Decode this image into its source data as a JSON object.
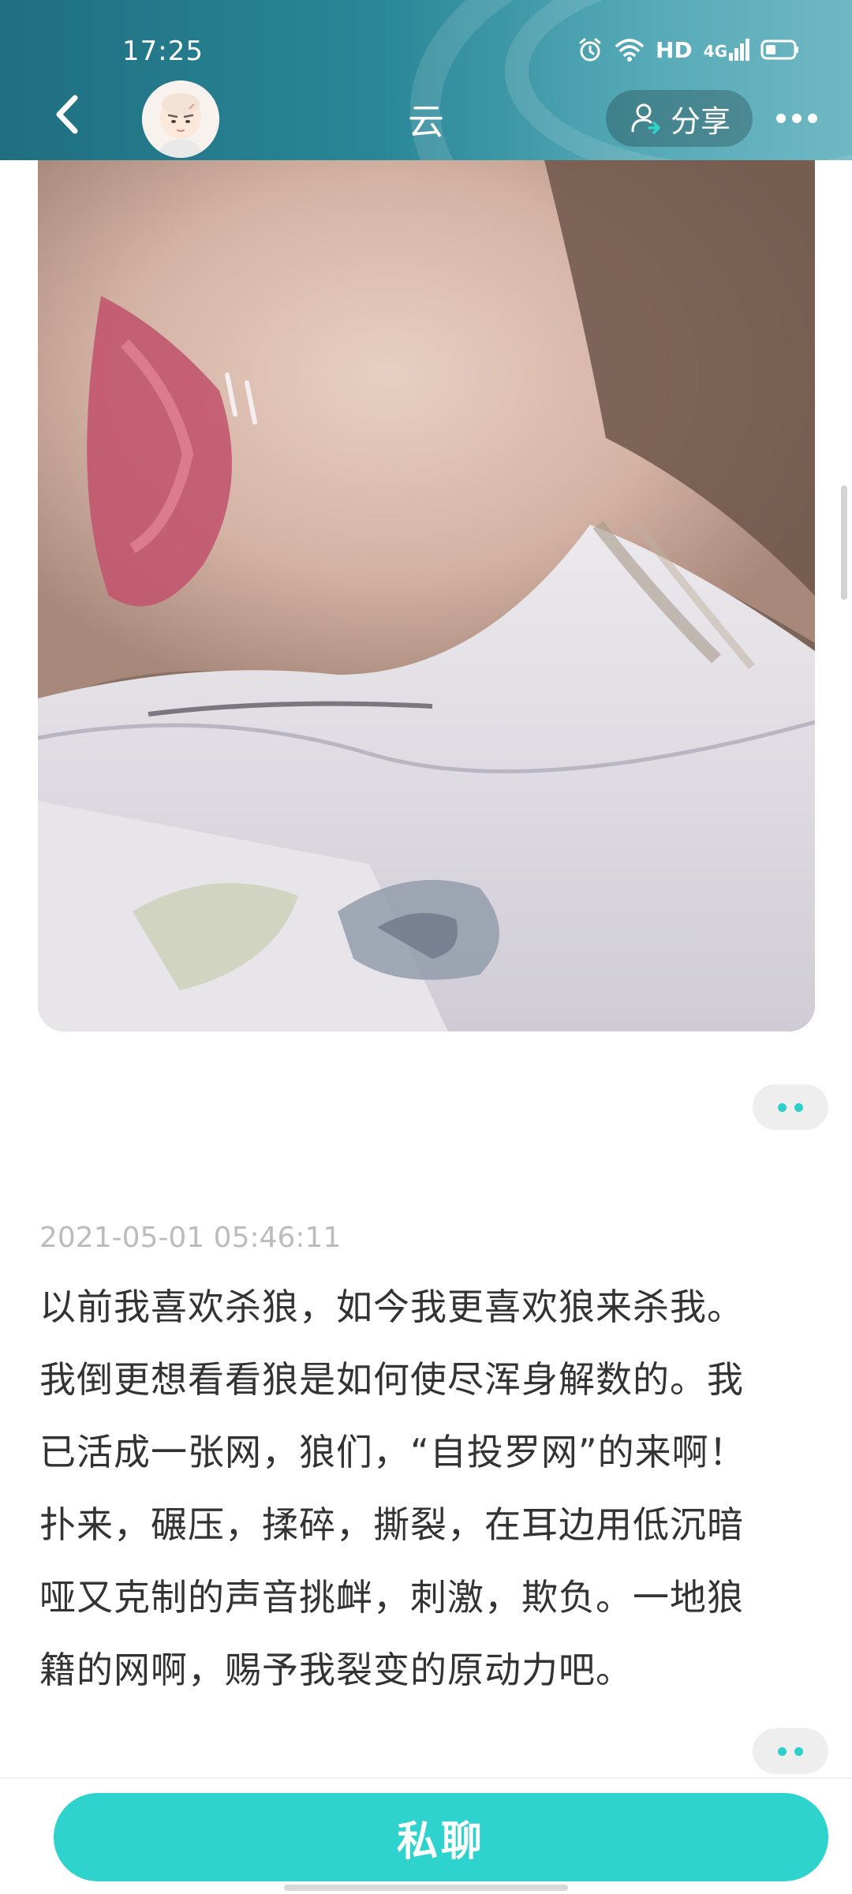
{
  "status_bar": {
    "time": "17:25",
    "network_label": "HD",
    "network_sub": "4G"
  },
  "header": {
    "title": "云",
    "share_label": "分享",
    "icons": {
      "back": "chevron-left-icon",
      "share": "user-share-icon",
      "more": "more-dots-icon"
    }
  },
  "post": {
    "timestamp": "2021-05-01 05:46:11",
    "text": "以前我喜欢杀狼，如今我更喜欢狼来杀我。\n我倒更想看看狼是如何使尽浑身解数的。我\n已活成一张网，狼们，“自投罗网”的来啊！\n扑来，碾压，揉碎，撕裂，在耳边用低沉暗\n哑又克制的声音挑衅，刺激，欺负。一地狼\n籍的网啊，赐予我裂变的原动力吧。"
  },
  "footer": {
    "chat_label": "私聊"
  },
  "colors": {
    "header_dark": "#1f6f80",
    "accent_teal": "#2dd3cc",
    "timestamp_gray": "#bcbcbc",
    "text_dark": "#333333"
  }
}
